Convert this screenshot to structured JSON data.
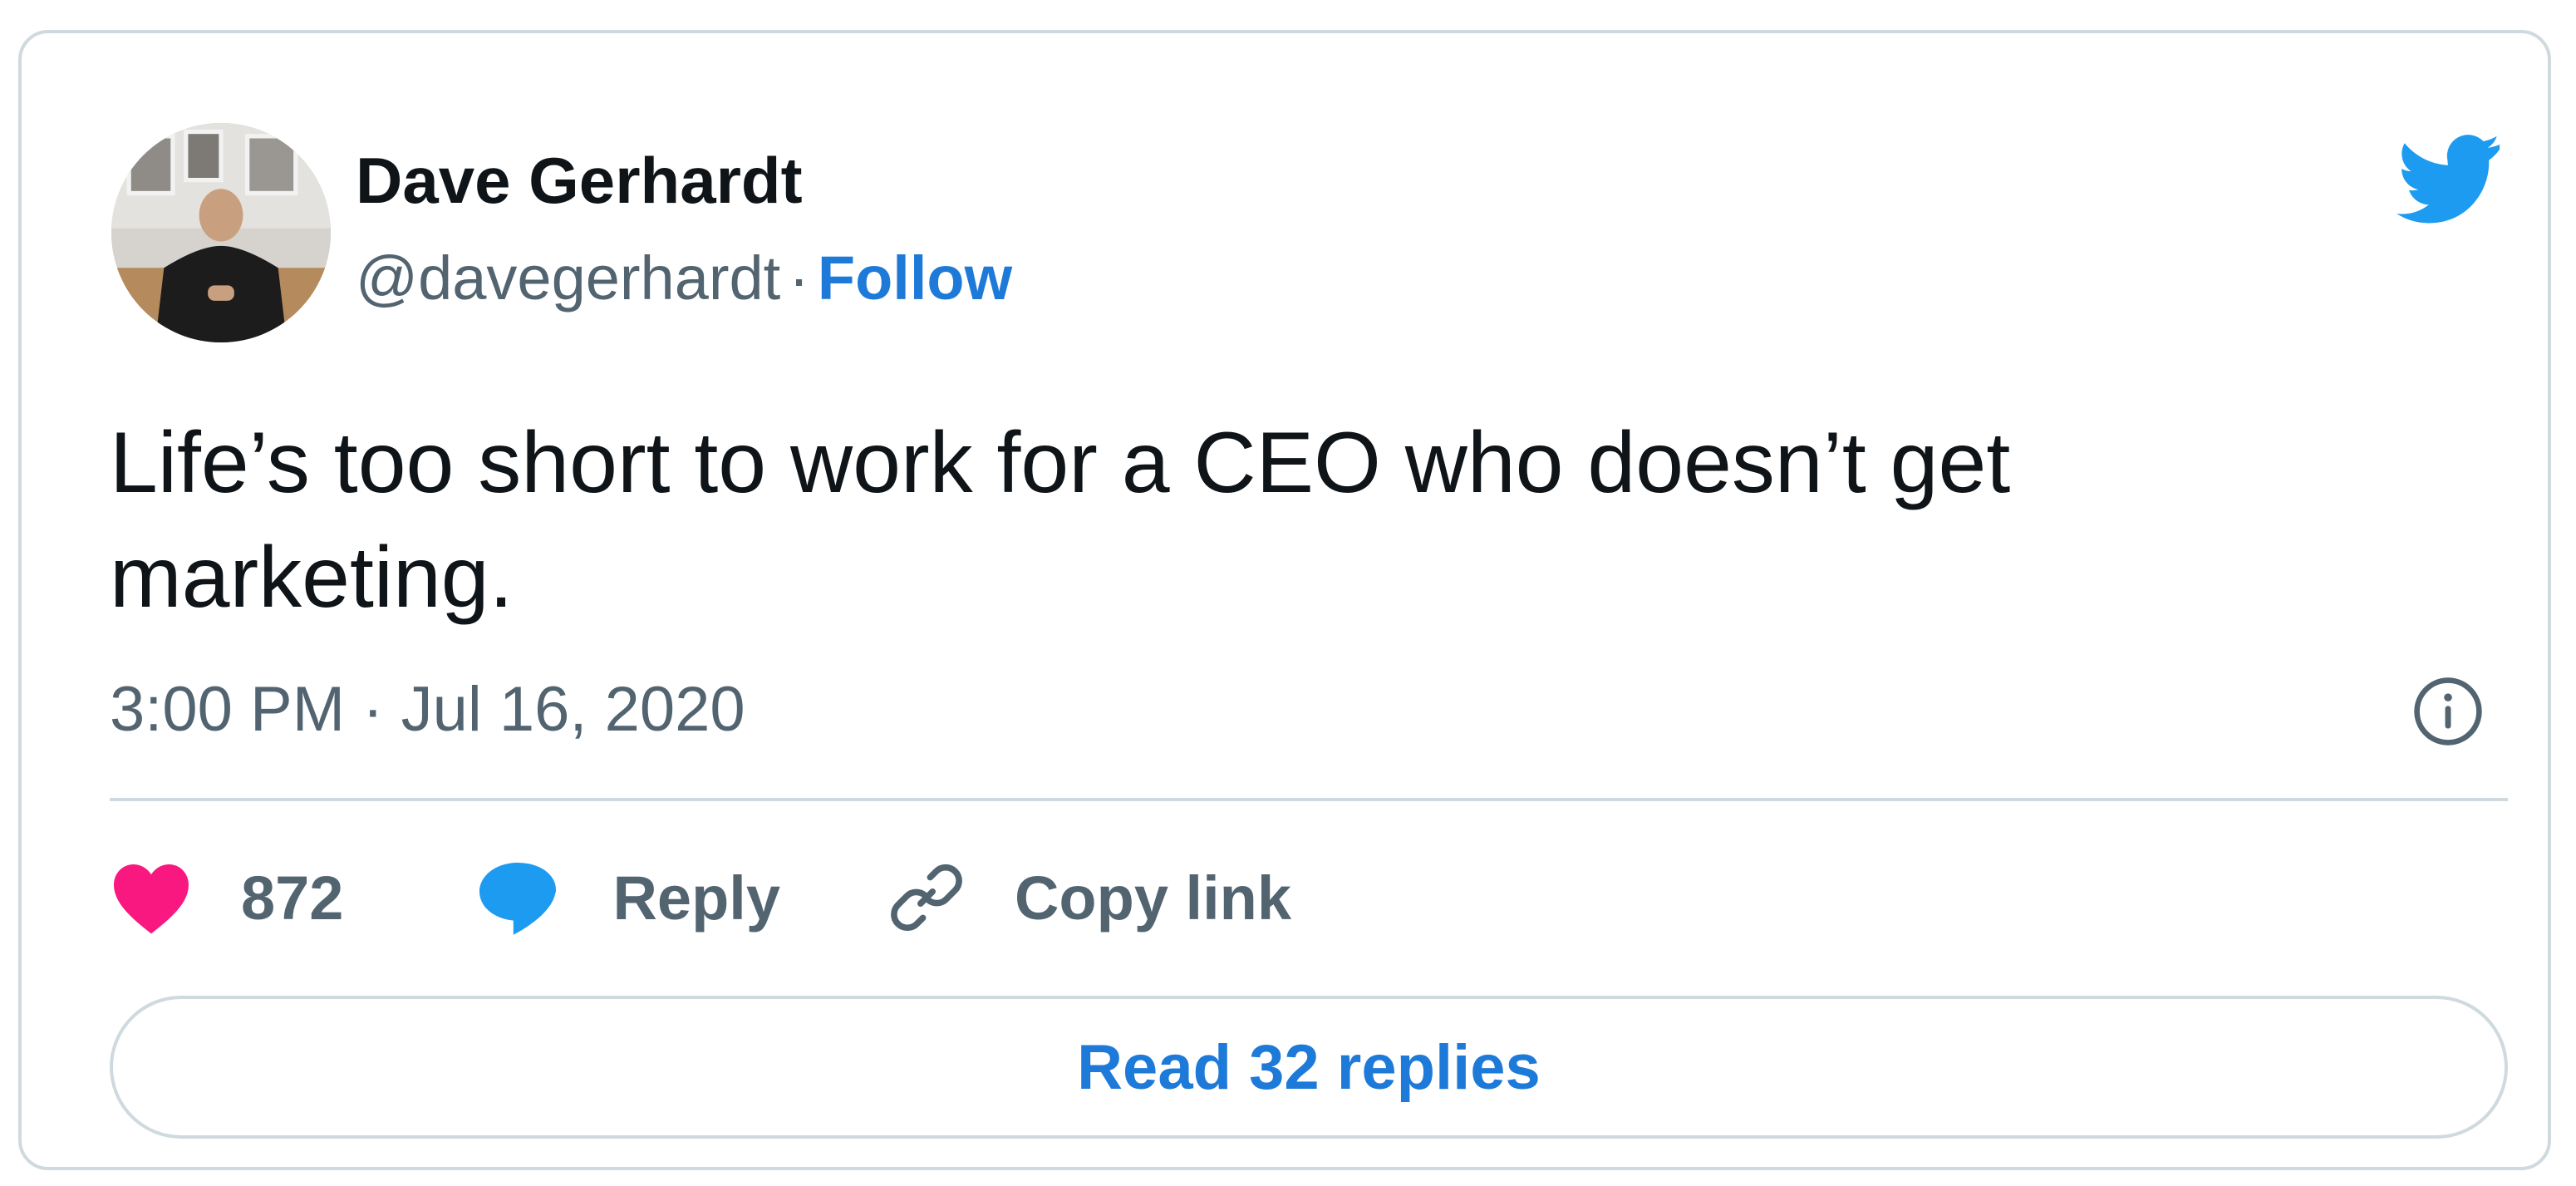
{
  "author": {
    "name": "Dave Gerhardt",
    "handle": "@davegerhardt",
    "separator": "·",
    "follow_label": "Follow"
  },
  "tweet": {
    "text": "Life’s too short to work for a CEO who doesn’t get marketing.",
    "timestamp": "3:00 PM · Jul 16, 2020"
  },
  "actions": {
    "like_count": "872",
    "reply_label": "Reply",
    "copy_link_label": "Copy link"
  },
  "read_replies_label": "Read 32 replies",
  "icons": {
    "brand": "twitter-bird-icon",
    "info": "info-icon",
    "like": "heart-icon",
    "reply": "speech-bubble-icon",
    "copy": "link-icon"
  },
  "colors": {
    "brand_blue": "#1d9bf0",
    "link_blue": "#1d7ad9",
    "like_pink": "#f91880",
    "text_primary": "#0f1419",
    "text_secondary": "#536471",
    "border": "#cfd9de"
  }
}
